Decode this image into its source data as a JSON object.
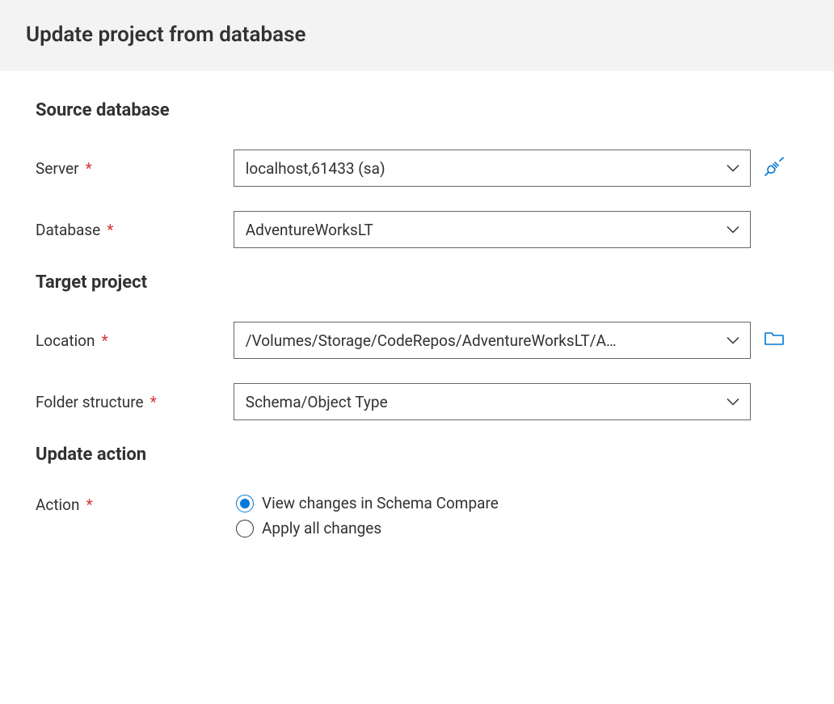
{
  "header": {
    "title": "Update project from database"
  },
  "sections": {
    "source": {
      "title": "Source database",
      "serverLabel": "Server",
      "serverValue": "localhost,61433 (sa)",
      "databaseLabel": "Database",
      "databaseValue": "AdventureWorksLT"
    },
    "target": {
      "title": "Target project",
      "locationLabel": "Location",
      "locationValue": "/Volumes/Storage/CodeRepos/AdventureWorksLT/A…",
      "folderStructureLabel": "Folder structure",
      "folderStructureValue": "Schema/Object Type"
    },
    "updateAction": {
      "title": "Update action",
      "actionLabel": "Action",
      "option1": "View changes in Schema Compare",
      "option2": "Apply all changes",
      "selected": "option1"
    }
  },
  "requiredMark": "*",
  "colors": {
    "accent": "#0078d4",
    "required": "#d13a3a"
  }
}
